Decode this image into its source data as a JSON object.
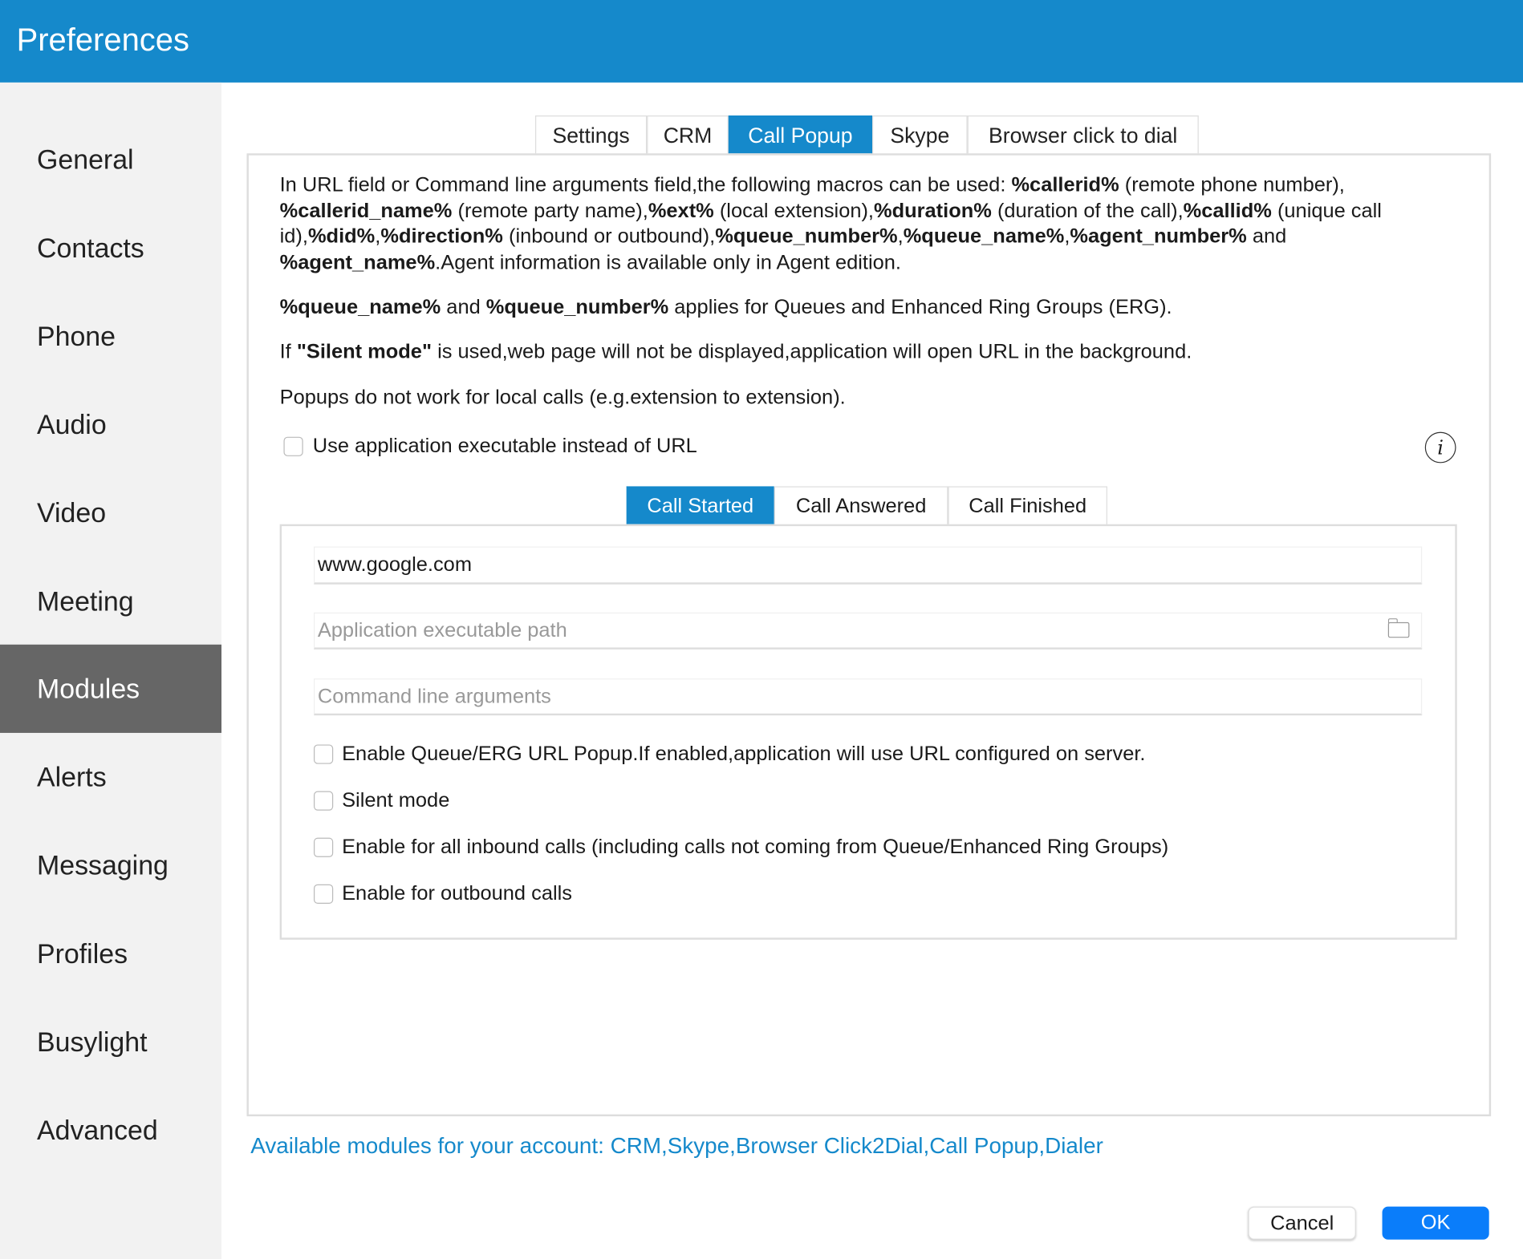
{
  "header": {
    "title": "Preferences"
  },
  "sidebar": {
    "items": [
      {
        "label": "General"
      },
      {
        "label": "Contacts"
      },
      {
        "label": "Phone"
      },
      {
        "label": "Audio"
      },
      {
        "label": "Video"
      },
      {
        "label": "Meeting"
      },
      {
        "label": "Modules",
        "active": true
      },
      {
        "label": "Alerts"
      },
      {
        "label": "Messaging"
      },
      {
        "label": "Profiles"
      },
      {
        "label": "Busylight"
      },
      {
        "label": "Advanced"
      }
    ]
  },
  "tabs": [
    {
      "label": "Settings"
    },
    {
      "label": "CRM"
    },
    {
      "label": "Call Popup",
      "active": true
    },
    {
      "label": "Skype"
    },
    {
      "label": "Browser click to dial"
    }
  ],
  "paragraphs": [
    [
      {
        "t": "In URL field or Command line arguments field,the following macros can be used: "
      },
      {
        "t": "%callerid%",
        "b": true
      },
      {
        "t": " (remote phone number), "
      },
      {
        "t": "%callerid_name%",
        "b": true
      },
      {
        "t": " (remote party name),"
      },
      {
        "t": "%ext%",
        "b": true
      },
      {
        "t": " (local extension),"
      },
      {
        "t": "%duration%",
        "b": true
      },
      {
        "t": " (duration of the call),"
      },
      {
        "t": "%callid%",
        "b": true
      },
      {
        "t": " (unique call id),"
      },
      {
        "t": "%did%",
        "b": true
      },
      {
        "t": ","
      },
      {
        "t": "%direction%",
        "b": true
      },
      {
        "t": " (inbound or outbound),"
      },
      {
        "t": "%queue_number%",
        "b": true
      },
      {
        "t": ","
      },
      {
        "t": "%queue_name%",
        "b": true
      },
      {
        "t": ","
      },
      {
        "t": "%agent_number%",
        "b": true
      },
      {
        "t": " and "
      },
      {
        "t": "%agent_name%",
        "b": true
      },
      {
        "t": ".Agent information is available only in Agent edition."
      }
    ],
    [
      {
        "t": "%queue_name%",
        "b": true
      },
      {
        "t": " and "
      },
      {
        "t": "%queue_number%",
        "b": true
      },
      {
        "t": " applies for Queues and Enhanced Ring Groups (ERG)."
      }
    ],
    [
      {
        "t": "If "
      },
      {
        "t": "\"Silent mode\"",
        "b": true
      },
      {
        "t": " is used,web page will not be displayed,application will open URL in the background."
      }
    ],
    [
      {
        "t": "Popups do not work for local calls (e.g.extension to extension)."
      }
    ]
  ],
  "use_executable": {
    "label": "Use application executable instead of URL",
    "checked": false
  },
  "info_icon": "info-icon",
  "inner_tabs": [
    {
      "label": "Call Started",
      "active": true
    },
    {
      "label": "Call Answered"
    },
    {
      "label": "Call Finished"
    }
  ],
  "fields": {
    "url": {
      "value": "www.google.com"
    },
    "app_path": {
      "placeholder": "Application executable path"
    },
    "cmd_args": {
      "placeholder": "Command line arguments"
    }
  },
  "options": [
    {
      "label": "Enable Queue/ERG URL Popup.If enabled,application will use URL configured on server.",
      "checked": false
    },
    {
      "label": "Silent mode",
      "checked": false
    },
    {
      "label": "Enable for all inbound calls (including calls not coming from Queue/Enhanced Ring Groups)",
      "checked": false
    },
    {
      "label": "Enable for outbound calls",
      "checked": false
    }
  ],
  "modules_text": "Available modules for your account: CRM,Skype,Browser Click2Dial,Call Popup,Dialer",
  "buttons": {
    "cancel": "Cancel",
    "ok": "OK"
  },
  "colors": {
    "accent": "#1589cb",
    "ok_button": "#0a7dfa",
    "sidebar_active": "#666666"
  }
}
